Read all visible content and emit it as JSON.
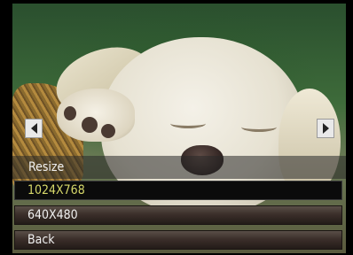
{
  "menu": {
    "title": "Resize",
    "options": [
      {
        "label": "1024X768",
        "selected": true
      },
      {
        "label": "640X480",
        "selected": false
      },
      {
        "label": "Back",
        "selected": false
      }
    ]
  },
  "colors": {
    "selected_text": "#d7d96a",
    "option_text": "#f0f0f0",
    "selected_bg": "#0b0b0b"
  },
  "icons": {
    "left": "arrow-left-icon",
    "right": "arrow-right-icon"
  }
}
